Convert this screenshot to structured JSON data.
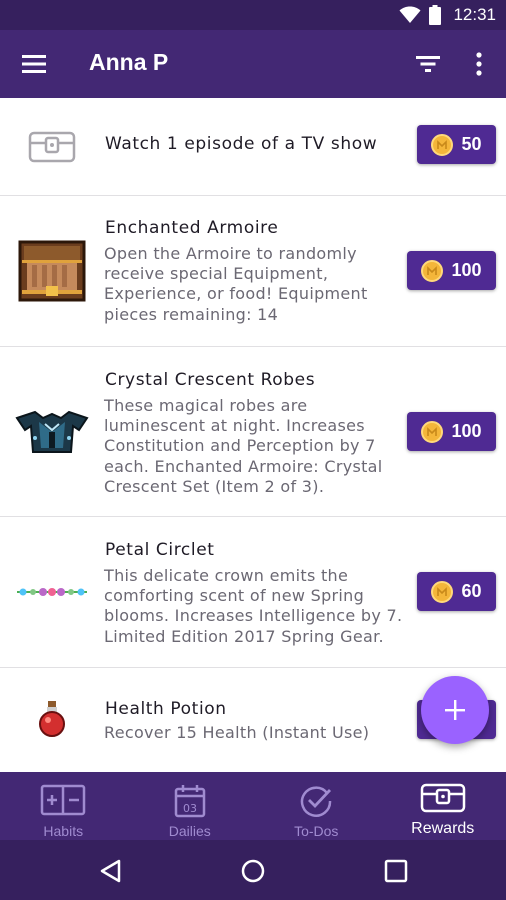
{
  "status_bar": {
    "time": "12:31"
  },
  "app_bar": {
    "title": "Anna P"
  },
  "rewards": [
    {
      "title": "Watch 1 episode of a TV show",
      "description": "",
      "price": "50",
      "icon": "custom-reward-chest-icon"
    },
    {
      "title": "Enchanted Armoire",
      "description": "Open the Armoire to randomly receive special Equipment, Experience, or food! Equipment pieces remaining: 14",
      "price": "100",
      "icon": "armoire-icon"
    },
    {
      "title": "Crystal Crescent Robes",
      "description": "These magical robes are luminescent at night. Increases Constitution and Perception by 7 each. Enchanted Armoire: Crystal Crescent Set (Item 2 of 3).",
      "price": "100",
      "icon": "robes-icon"
    },
    {
      "title": "Petal Circlet",
      "description": "This delicate crown emits the comforting scent of new Spring blooms. Increases Intelligence by 7. Limited Edition 2017 Spring Gear.",
      "price": "60",
      "icon": "circlet-icon"
    },
    {
      "title": "Health Potion",
      "description": "Recover 15 Health (Instant Use)",
      "price": "",
      "icon": "health-potion-icon"
    }
  ],
  "currency_icon": "gold-coin-icon",
  "fab": {
    "icon": "plus-icon"
  },
  "bottom_nav": {
    "tabs": [
      {
        "label": "Habits",
        "icon": "habits-icon"
      },
      {
        "label": "Dailies",
        "icon": "calendar-icon",
        "icon_text": "03"
      },
      {
        "label": "To-Dos",
        "icon": "checkmark-icon"
      },
      {
        "label": "Rewards",
        "icon": "reward-chest-icon",
        "active": true
      }
    ]
  },
  "colors": {
    "status_bar": "#36205e",
    "app_bar": "#432874",
    "price_button": "#4f2a93",
    "fab": "#9a62ff",
    "gold": "#f4b63a"
  }
}
